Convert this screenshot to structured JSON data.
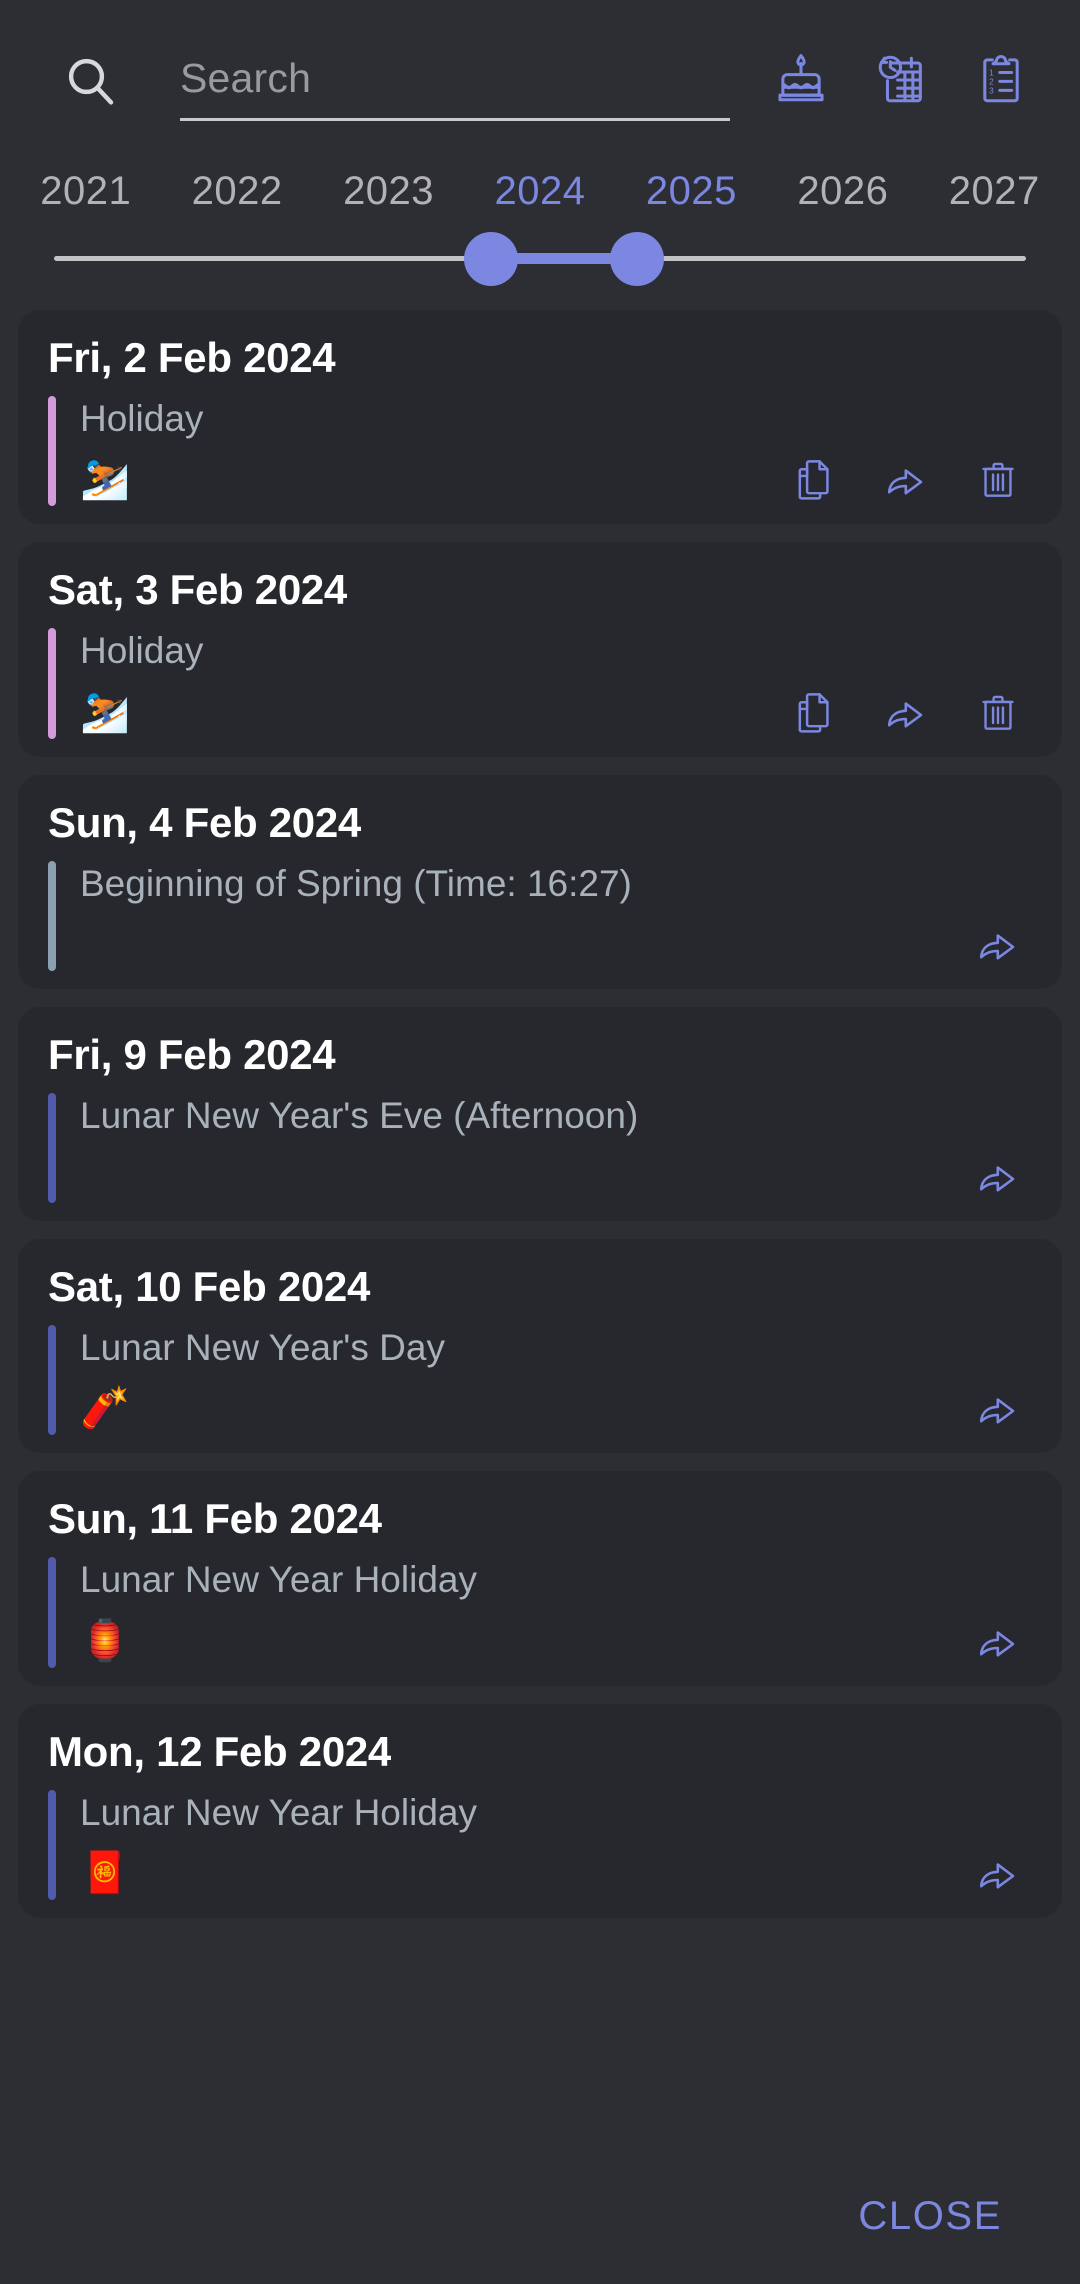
{
  "colors": {
    "background": "#2c2e33",
    "card": "#26282d",
    "accent": "#7b87e0",
    "date_text": "#ffffff",
    "entry_text": "#a9b2bb",
    "year_inactive": "#b2b2b6"
  },
  "search": {
    "placeholder": "Search",
    "value": "",
    "icon": "search-icon"
  },
  "header_actions": [
    {
      "name": "birthday-cake-icon",
      "label": "Birthdays"
    },
    {
      "name": "calendar-clock-icon",
      "label": "Event history"
    },
    {
      "name": "clipboard-list-icon",
      "label": "Checklist"
    }
  ],
  "year_slider": {
    "years": [
      {
        "label": "2021",
        "active": false
      },
      {
        "label": "2022",
        "active": false
      },
      {
        "label": "2023",
        "active": false
      },
      {
        "label": "2024",
        "active": true
      },
      {
        "label": "2025",
        "active": true
      },
      {
        "label": "2026",
        "active": false
      },
      {
        "label": "2027",
        "active": false
      }
    ],
    "start_year": "2024",
    "end_year": "2025",
    "start_percent": 45,
    "end_percent": 60
  },
  "events": [
    {
      "date": "Fri, 2 Feb 2024",
      "title": "Holiday",
      "emoji": "⛷️",
      "accent_color": "#d39bd9",
      "actions": [
        "copy-icon",
        "share-icon",
        "delete-icon"
      ]
    },
    {
      "date": "Sat, 3 Feb 2024",
      "title": "Holiday",
      "emoji": "⛷️",
      "accent_color": "#d39bd9",
      "actions": [
        "copy-icon",
        "share-icon",
        "delete-icon"
      ]
    },
    {
      "date": "Sun, 4 Feb 2024",
      "title": "Beginning of Spring (Time: 16:27)",
      "emoji": "",
      "accent_color": "#8ba0b0",
      "actions": [
        "share-icon"
      ]
    },
    {
      "date": "Fri, 9 Feb 2024",
      "title": "Lunar New Year's Eve (Afternoon)",
      "emoji": "",
      "accent_color": "#515bac",
      "actions": [
        "share-icon"
      ]
    },
    {
      "date": "Sat, 10 Feb 2024",
      "title": "Lunar New Year's Day",
      "emoji": "🧨",
      "accent_color": "#515bac",
      "actions": [
        "share-icon"
      ]
    },
    {
      "date": "Sun, 11 Feb 2024",
      "title": "Lunar New Year Holiday",
      "emoji": "🏮",
      "accent_color": "#515bac",
      "actions": [
        "share-icon"
      ]
    },
    {
      "date": "Mon, 12 Feb 2024",
      "title": "Lunar New Year Holiday",
      "emoji": "🧧",
      "accent_color": "#515bac",
      "actions": [
        "share-icon"
      ]
    }
  ],
  "footer": {
    "close_label": "CLOSE"
  }
}
